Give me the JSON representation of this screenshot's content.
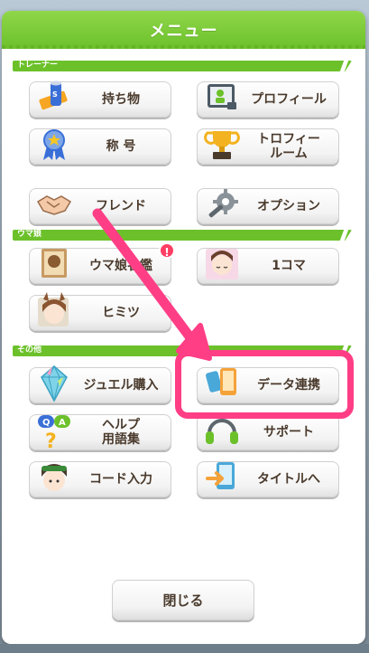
{
  "header": {
    "title": "メニュー"
  },
  "sections": {
    "trainer": "トレーナー",
    "umamusume": "ウマ娘",
    "other": "その他"
  },
  "buttons": {
    "items": "持ち物",
    "profile": "プロフィール",
    "title_name": "称 号",
    "trophy_room": "トロフィー\nルーム",
    "friends": "フレンド",
    "options": "オプション",
    "uma_guide": "ウマ娘名鑑",
    "one_koma": "1コマ",
    "secrets": "ヒミツ",
    "jewel_purchase": "ジュエル購入",
    "data_link": "データ連携",
    "help_glossary": "ヘルプ\n用語集",
    "support": "サポート",
    "code_input": "コード入力",
    "to_title": "タイトルへ"
  },
  "badge": {
    "uma_guide": "!"
  },
  "close": {
    "label": "閉じる"
  },
  "colors": {
    "accent_green": "#6cc12b",
    "highlight_pink": "#ff3e86",
    "badge_red": "#ff3e63"
  }
}
